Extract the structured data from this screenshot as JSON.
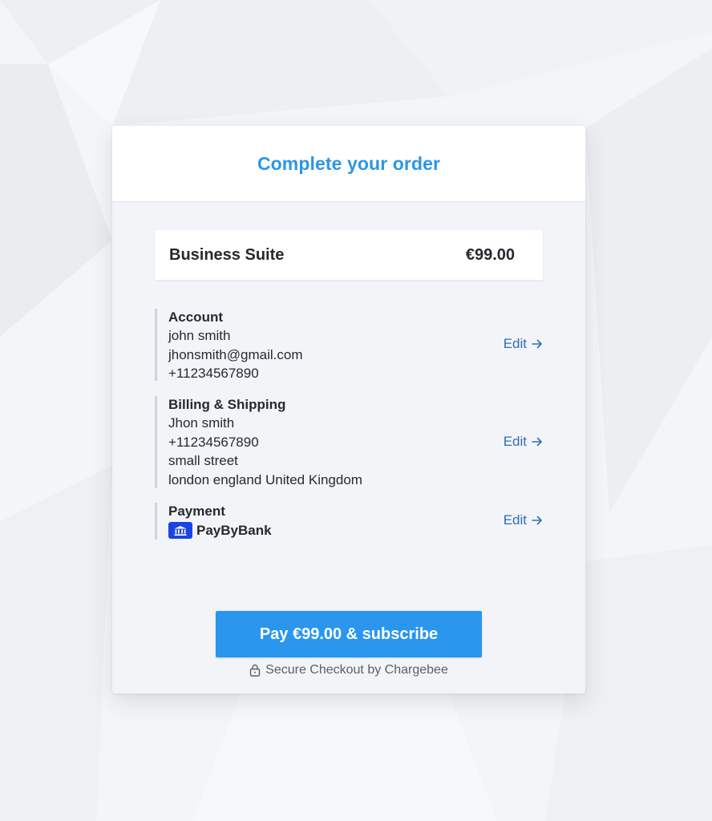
{
  "checkout": {
    "title": "Complete your order",
    "plan": {
      "name": "Business Suite",
      "price": "€99.00"
    },
    "sections": {
      "account": {
        "title": "Account",
        "name": "john smith",
        "email": "jhonsmith@gmail.com",
        "phone": "+11234567890",
        "edit_label": "Edit"
      },
      "billing": {
        "title": "Billing & Shipping",
        "name": "Jhon smith",
        "phone": "+11234567890",
        "street": "small street",
        "city_line": "london england United Kingdom",
        "edit_label": "Edit"
      },
      "payment": {
        "title": "Payment",
        "method": "PayByBank",
        "method_icon": "bank-icon",
        "edit_label": "Edit"
      }
    },
    "pay_button_label": "Pay €99.00 & subscribe",
    "secure_text": "Secure Checkout by Chargebee",
    "colors": {
      "accent": "#2a96ee",
      "title": "#2a96e8",
      "link": "#2f6fb3",
      "bank_badge": "#1a44e6"
    }
  }
}
